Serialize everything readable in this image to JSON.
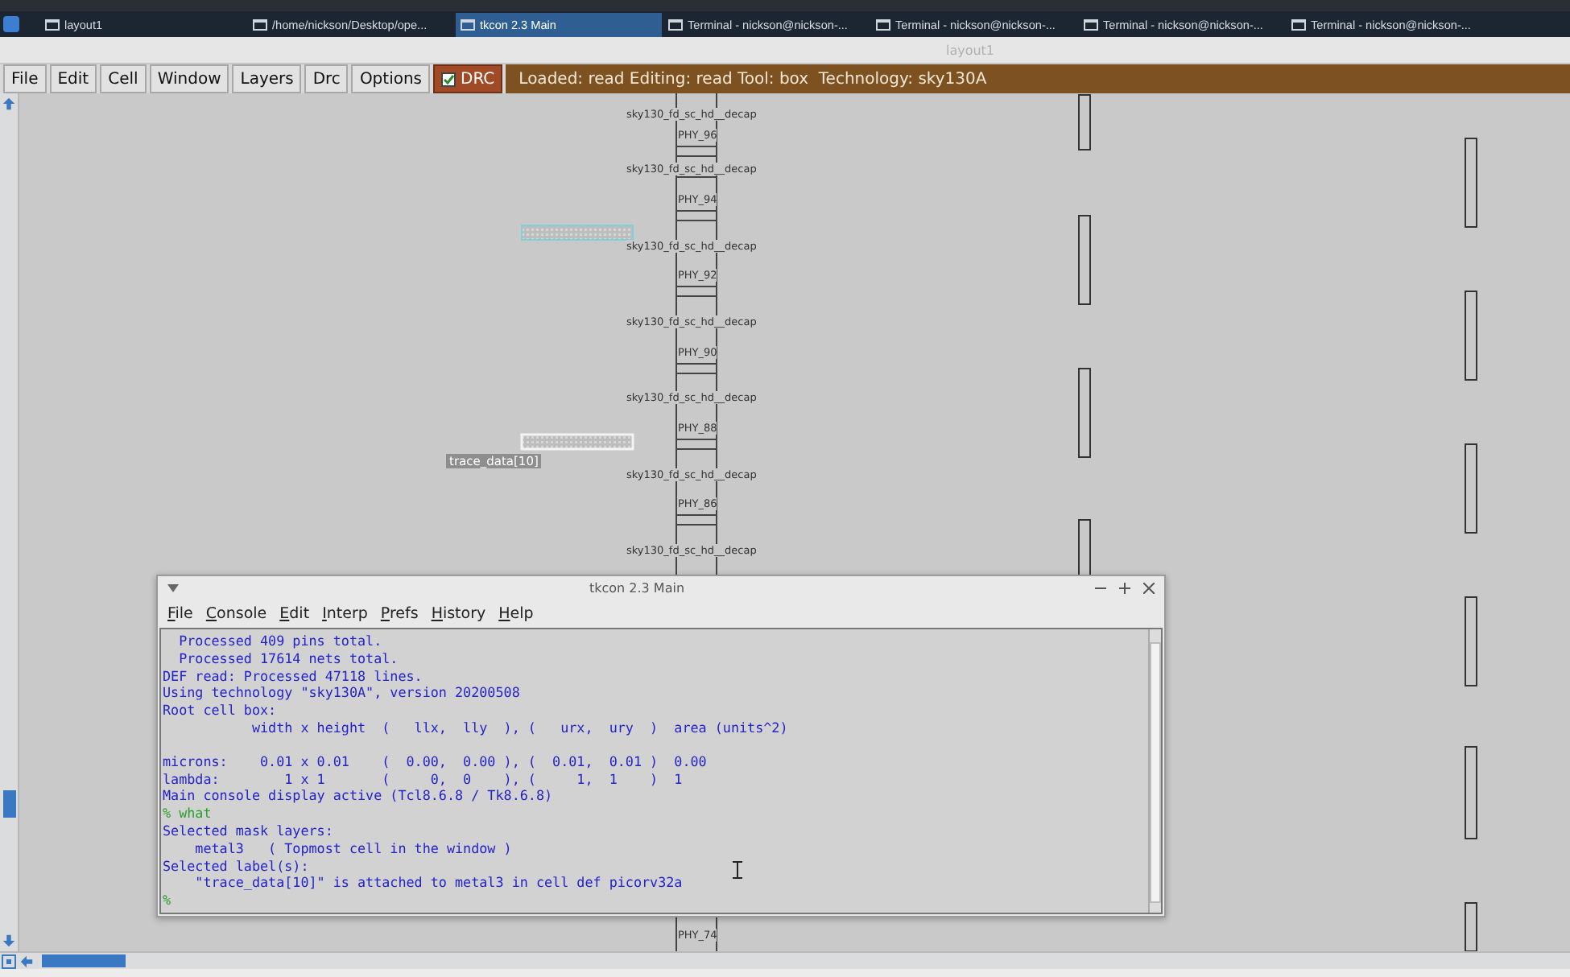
{
  "taskbar": {
    "items": [
      {
        "label": "layout1",
        "selected": false
      },
      {
        "label": "/home/nickson/Desktop/ope...",
        "selected": false
      },
      {
        "label": "tkcon 2.3 Main",
        "selected": true
      },
      {
        "label": "Terminal - nickson@nickson-...",
        "selected": false
      },
      {
        "label": "Terminal - nickson@nickson-...",
        "selected": false
      },
      {
        "label": "Terminal - nickson@nickson-...",
        "selected": false
      },
      {
        "label": "Terminal - nickson@nickson-...",
        "selected": false
      }
    ]
  },
  "window": {
    "title": "layout1"
  },
  "toolbar": {
    "buttons": [
      "File",
      "Edit",
      "Cell",
      "Window",
      "Layers",
      "Drc",
      "Options"
    ],
    "drc": {
      "label": "DRC",
      "checked": true
    },
    "status": "Loaded: read Editing: read Tool: box  Technology: sky130A"
  },
  "layout": {
    "cell_labels": [
      "sky130_fd_sc_hd__decap",
      "sky130_fd_sc_hd__decap",
      "sky130_fd_sc_hd__decap",
      "sky130_fd_sc_hd__decap",
      "sky130_fd_sc_hd__decap",
      "sky130_fd_sc_hd__decap",
      "sky130_fd_sc_hd__decap"
    ],
    "pin_labels": [
      "PHY_96",
      "PHY_94",
      "PHY_92",
      "PHY_90",
      "PHY_88",
      "PHY_86",
      "PHY_74"
    ],
    "net_label": "trace_data[10]"
  },
  "console": {
    "title": "tkcon 2.3 Main",
    "menu": [
      "File",
      "Console",
      "Edit",
      "Interp",
      "Prefs",
      "History",
      "Help"
    ],
    "lines": [
      {
        "kind": "output",
        "text": "  Processed 409 pins total."
      },
      {
        "kind": "output",
        "text": "  Processed 17614 nets total."
      },
      {
        "kind": "output",
        "text": "DEF read: Processed 47118 lines."
      },
      {
        "kind": "output",
        "text": "Using technology \"sky130A\", version 20200508"
      },
      {
        "kind": "output",
        "text": "Root cell box:"
      },
      {
        "kind": "output",
        "text": "           width x height  (   llx,  lly  ), (   urx,  ury  )  area (units^2)"
      },
      {
        "kind": "blank"
      },
      {
        "kind": "output",
        "text": "microns:    0.01 x 0.01    (  0.00,  0.00 ), (  0.01,  0.01 )  0.00"
      },
      {
        "kind": "output",
        "text": "lambda:        1 x 1       (     0,  0    ), (     1,  1    )  1"
      },
      {
        "kind": "output",
        "text": "Main console display active (Tcl8.6.8 / Tk8.6.8)"
      },
      {
        "kind": "command",
        "prompt": "%",
        "text": "what"
      },
      {
        "kind": "output",
        "text": "Selected mask layers:"
      },
      {
        "kind": "output",
        "text": "    metal3   ( Topmost cell in the window )"
      },
      {
        "kind": "output",
        "text": "Selected label(s):"
      },
      {
        "kind": "output",
        "text": "    \"trace_data[10]\" is attached to metal3 in cell def picorv32a"
      },
      {
        "kind": "command",
        "prompt": "%"
      }
    ]
  }
}
